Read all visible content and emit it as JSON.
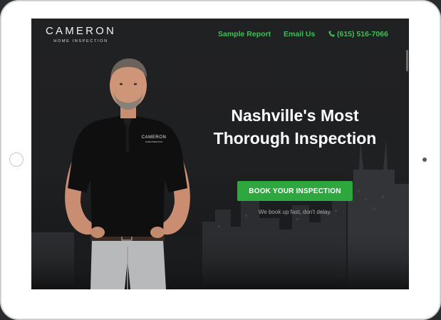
{
  "brand": {
    "name": "CAMERON",
    "tagline": "HOME INSPECTION"
  },
  "nav": {
    "sample_report": "Sample Report",
    "email_us": "Email Us",
    "phone": "(615) 516-7066"
  },
  "hero": {
    "headline_line1": "Nashville's Most",
    "headline_line2": "Thorough Inspection",
    "cta_label": "BOOK YOUR INSPECTION",
    "cta_subtext": "We book up fast, don't delay."
  },
  "shirt_logo": {
    "name": "CAMERON",
    "tagline": "HOME INSPECTION"
  },
  "colors": {
    "accent": "#3fc056",
    "cta": "#2ea73f",
    "background": "#1f2022"
  },
  "icons": [
    "phone-icon",
    "home-button-icon",
    "camera-icon"
  ]
}
